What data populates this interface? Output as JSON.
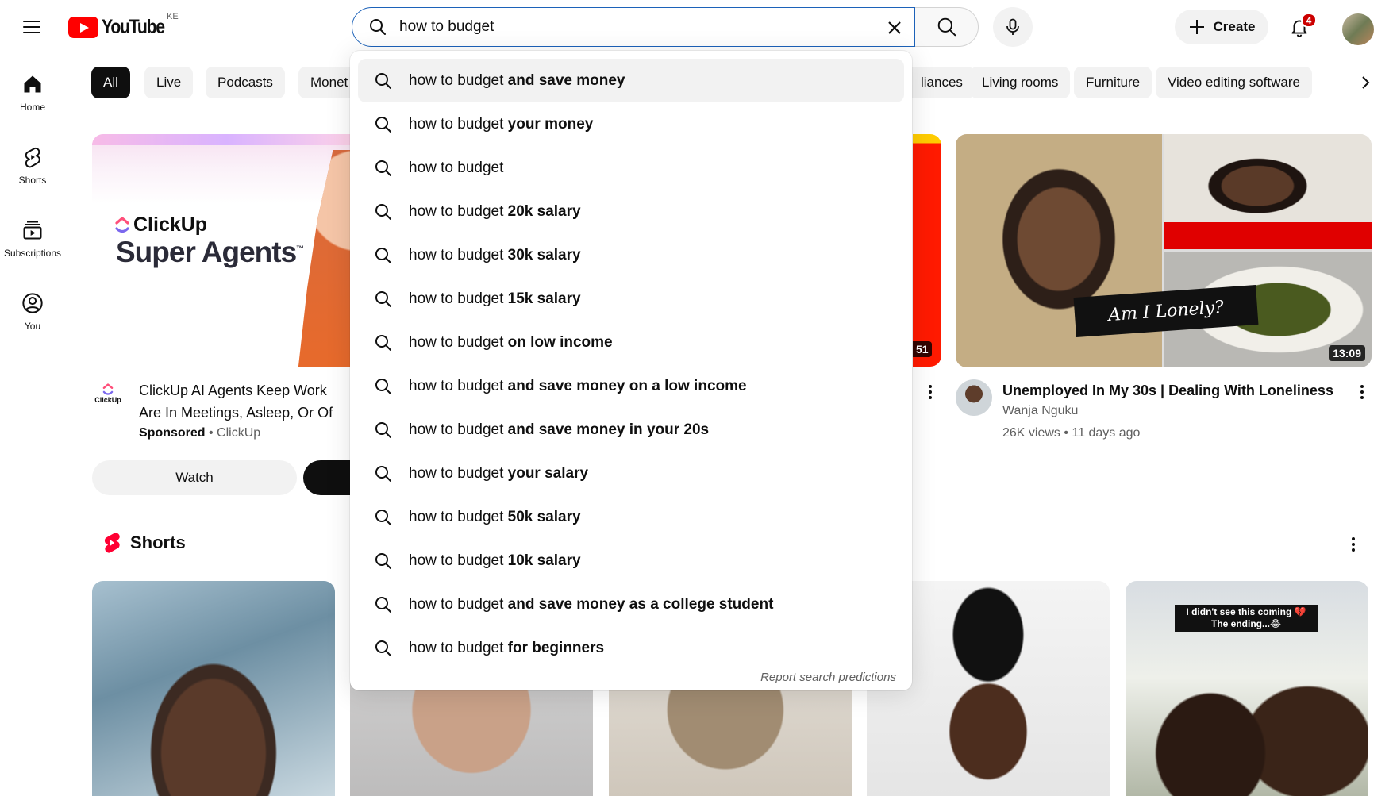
{
  "header": {
    "logo_text": "YouTube",
    "country_code": "KE",
    "search_value": "how to budget",
    "create_label": "Create",
    "notification_count": "4"
  },
  "sidebar": {
    "items": [
      {
        "label": "Home",
        "icon": "home-icon"
      },
      {
        "label": "Shorts",
        "icon": "shorts-icon"
      },
      {
        "label": "Subscriptions",
        "icon": "subscriptions-icon"
      },
      {
        "label": "You",
        "icon": "you-icon"
      }
    ]
  },
  "chips": {
    "items": [
      "All",
      "Live",
      "Podcasts",
      "Monet",
      "liances",
      "Living rooms",
      "Furniture",
      "Video editing software"
    ]
  },
  "ad": {
    "brand_logo": "ClickUp",
    "headline": "Super Agents",
    "trademark": "™",
    "channel_logo_label": "ClickUp",
    "title": "ClickUp AI Agents Keep Work Are In Meetings, Asleep, Or Of",
    "title_line1": "ClickUp AI Agents Keep Work",
    "title_line2": "Are In Meetings, Asleep, Or Of",
    "sponsored": "Sponsored",
    "advertiser": " • ClickUp",
    "watch_label": "Watch"
  },
  "middle_video": {
    "duration_fragment": "51"
  },
  "video": {
    "thumbnail_caption": "Am I Lonely?",
    "duration": "13:09",
    "title": "Unemployed In My 30s | Dealing With Loneliness",
    "channel": "Wanja Nguku",
    "meta": "26K views • 11 days ago"
  },
  "shorts": {
    "title": "Shorts",
    "items": [
      {
        "caption": ""
      },
      {
        "caption": ""
      },
      {
        "caption": ""
      },
      {
        "caption": ""
      },
      {
        "caption": "I didn't see this coming 💔 The ending...😂"
      }
    ]
  },
  "suggestions": {
    "base": "how to budget",
    "items": [
      {
        "rest": " and save money"
      },
      {
        "rest": " your money"
      },
      {
        "rest": ""
      },
      {
        "rest": " 20k salary"
      },
      {
        "rest": " 30k salary"
      },
      {
        "rest": " 15k salary"
      },
      {
        "rest": " on low income"
      },
      {
        "rest": " and save money on a low income"
      },
      {
        "rest": " and save money in your 20s"
      },
      {
        "rest": " your salary"
      },
      {
        "rest": " 50k salary"
      },
      {
        "rest": " 10k salary"
      },
      {
        "rest": " and save money as a college student"
      },
      {
        "rest": " for beginners"
      }
    ],
    "report_label": "Report search predictions"
  },
  "colors": {
    "brand_red": "#ff0000",
    "search_focus": "#1c62b9",
    "chip_active": "#0f0f0f",
    "chip_bg": "#f2f2f2"
  }
}
